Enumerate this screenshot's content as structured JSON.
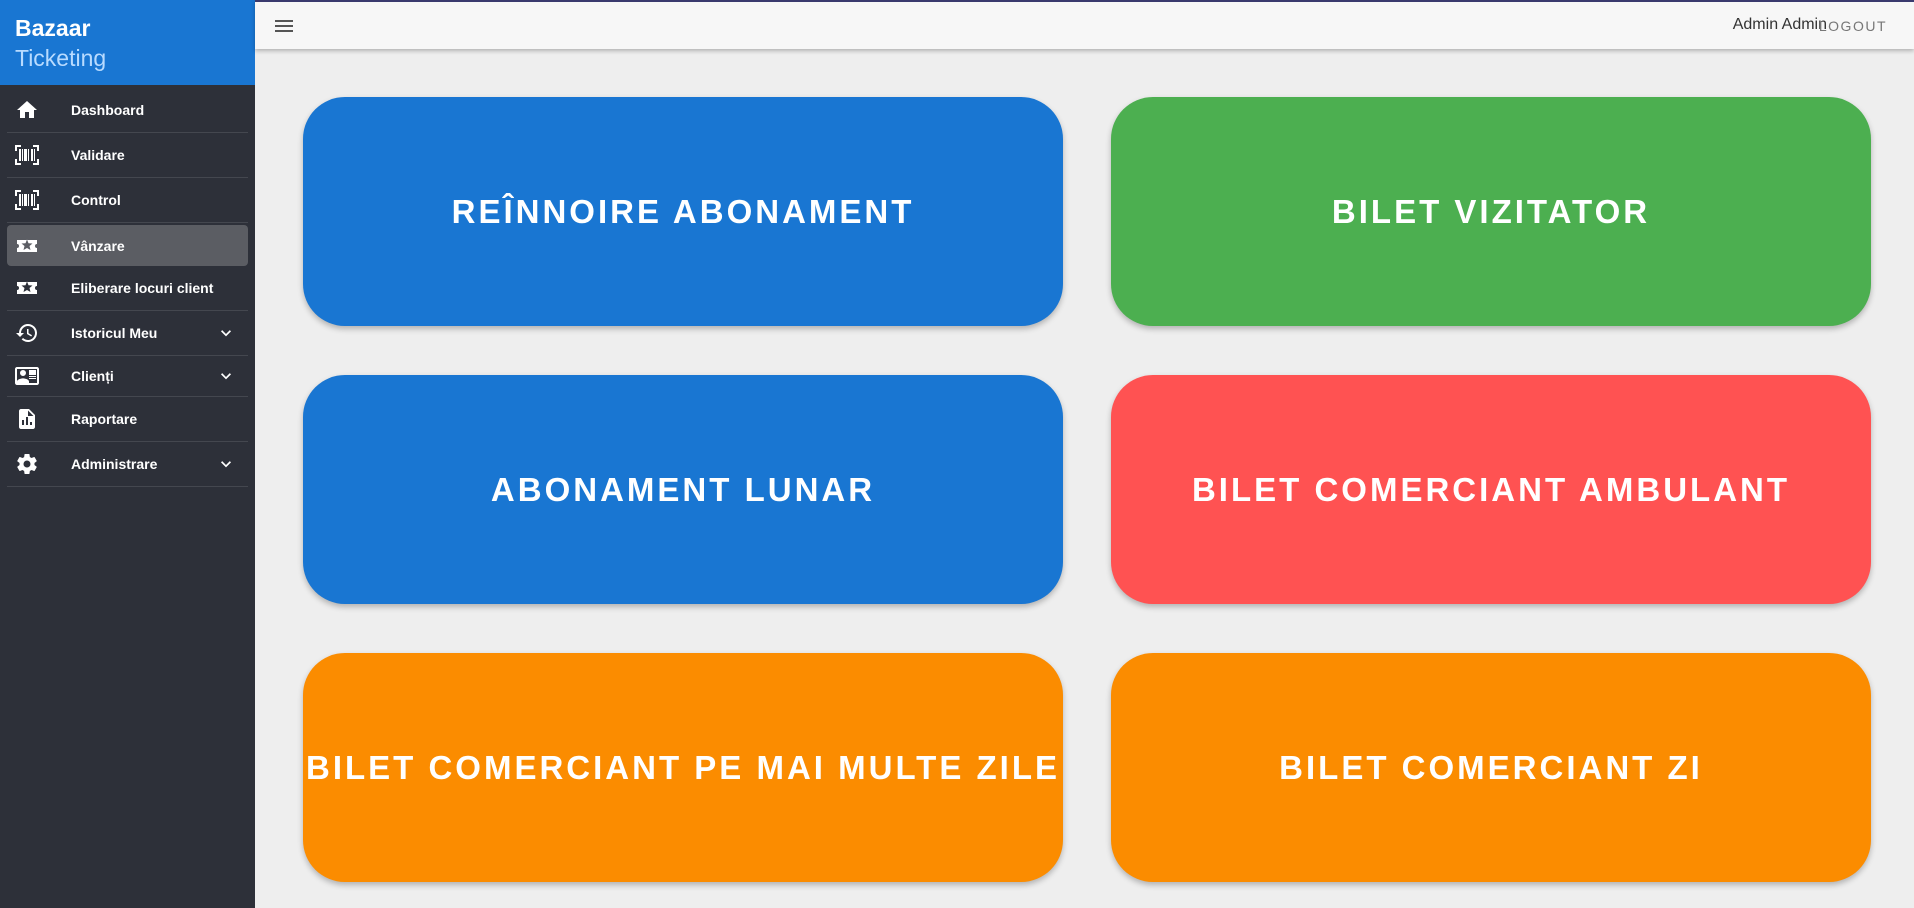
{
  "brand": {
    "line1": "Bazaar",
    "line2": "Ticketing"
  },
  "nav": [
    {
      "label": "Dashboard",
      "icon": "home-icon"
    },
    {
      "label": "Validare",
      "icon": "barcode-scan-icon"
    },
    {
      "label": "Control",
      "icon": "barcode-scan-icon"
    },
    {
      "label": "Vânzare",
      "icon": "ticket-star-icon",
      "active": true
    },
    {
      "label": "Eliberare locuri client",
      "icon": "ticket-star-icon"
    },
    {
      "label": "Istoricul Meu",
      "icon": "history-icon",
      "expandable": true
    },
    {
      "label": "Clienți",
      "icon": "card-account-icon",
      "expandable": true
    },
    {
      "label": "Raportare",
      "icon": "report-file-icon"
    },
    {
      "label": "Administrare",
      "icon": "gear-icon",
      "expandable": true
    }
  ],
  "topbar": {
    "user": "Admin Admin",
    "logout": "LOGOUT"
  },
  "tiles": [
    {
      "label": "REÎNNOIRE ABONAMENT",
      "color": "#1976d2"
    },
    {
      "label": "BILET VIZITATOR",
      "color": "#4caf50"
    },
    {
      "label": "ABONAMENT LUNAR",
      "color": "#1976d2"
    },
    {
      "label": "BILET COMERCIANT AMBULANT",
      "color": "#ff5252"
    },
    {
      "label": "BILET COMERCIANT PE MAI MULTE ZILE",
      "color": "#fb8c00"
    },
    {
      "label": "BILET COMERCIANT ZI",
      "color": "#fb8c00"
    }
  ]
}
